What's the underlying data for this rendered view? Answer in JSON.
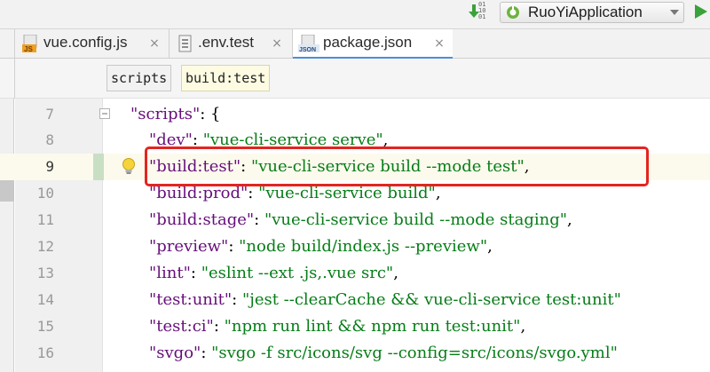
{
  "toolbar": {
    "run_config_label": "RuoYiApplication",
    "binary_icon_text": [
      "0",
      "1",
      "1",
      "0",
      "0",
      "1"
    ]
  },
  "tabs": [
    {
      "label": "vue.config.js",
      "icon": "js-file-icon",
      "active": false
    },
    {
      "label": ".env.test",
      "icon": "text-file-icon",
      "active": false
    },
    {
      "label": "package.json",
      "icon": "json-file-icon",
      "active": true
    }
  ],
  "tab_close_glyph": "×",
  "file_icons": {
    "js": "JS",
    "json": "JSON"
  },
  "breadcrumb": [
    "scripts",
    "build:test"
  ],
  "editor": {
    "current_line": 9,
    "lines": [
      {
        "num": "7",
        "key": "\"scripts\"",
        "sep": ": {",
        "value": "",
        "end": ""
      },
      {
        "num": "8",
        "key": "\"dev\"",
        "sep": ": ",
        "value": "\"vue-cli-service serve\"",
        "end": ","
      },
      {
        "num": "9",
        "key": "\"build:test\"",
        "sep": ": ",
        "value": "\"vue-cli-service build --mode test\"",
        "end": ","
      },
      {
        "num": "10",
        "key": "\"build:prod\"",
        "sep": ": ",
        "value": "\"vue-cli-service build\"",
        "end": ","
      },
      {
        "num": "11",
        "key": "\"build:stage\"",
        "sep": ": ",
        "value": "\"vue-cli-service build --mode staging\"",
        "end": ","
      },
      {
        "num": "12",
        "key": "\"preview\"",
        "sep": ": ",
        "value": "\"node build/index.js --preview\"",
        "end": ","
      },
      {
        "num": "13",
        "key": "\"lint\"",
        "sep": ": ",
        "value": "\"eslint --ext .js,.vue src\"",
        "end": ","
      },
      {
        "num": "14",
        "key": "\"test:unit\"",
        "sep": ": ",
        "value": "\"jest --clearCache && vue-cli-service test:unit\"",
        "end": ""
      },
      {
        "num": "15",
        "key": "\"test:ci\"",
        "sep": ": ",
        "value": "\"npm run lint && npm run test:unit\"",
        "end": ","
      },
      {
        "num": "16",
        "key": "\"svgo\"",
        "sep": ": ",
        "value": "\"svgo -f src/icons/svg --config=src/icons/svgo.yml\"",
        "end": ""
      }
    ]
  },
  "colors": {
    "key": "#660e7a",
    "string": "#067d17",
    "highlight_box": "#e3251f",
    "active_tab_underline": "#4a90d9"
  }
}
